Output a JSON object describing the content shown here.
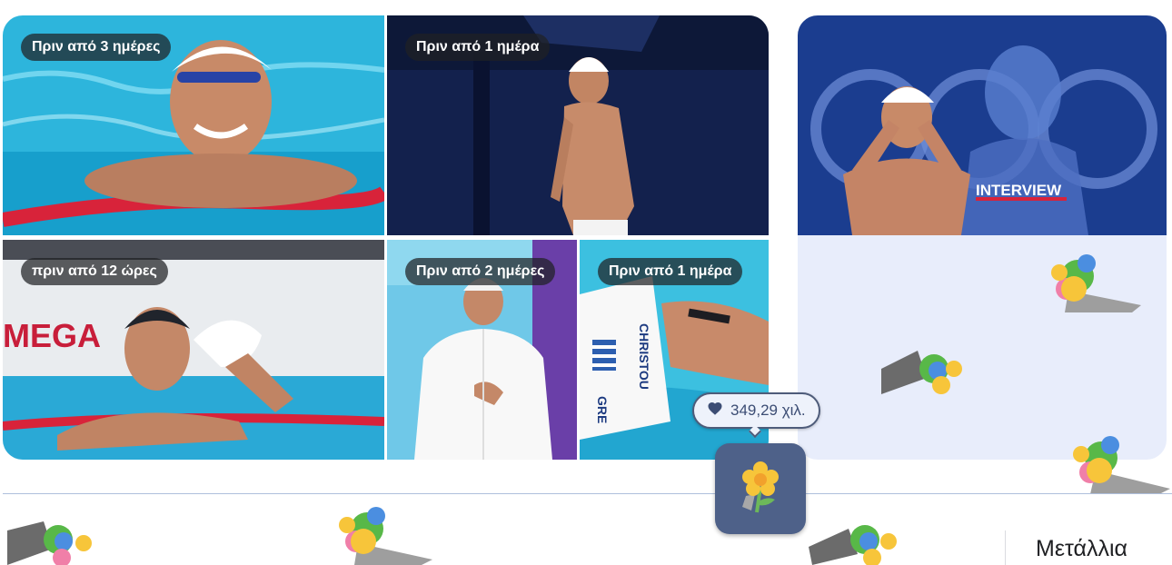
{
  "gallery": {
    "tiles": [
      {
        "badge": "Πριν από 3 ημέρες",
        "scene": "swimmer-smiling-in-pool"
      },
      {
        "badge": "Πριν από 1 ημέρα",
        "scene": "swimmer-on-starting-block"
      },
      {
        "badge": "πριν από 12 ώρες",
        "scene": "swimmer-holding-cap-at-wall"
      },
      {
        "badge": "Πριν από 2 ημέρες",
        "scene": "swimmer-in-white-jacket"
      },
      {
        "badge": "Πριν από 1 ημέρα",
        "scene": "swimmer-backstroke-cap-gre"
      }
    ]
  },
  "side_card": {
    "image_overlay_text": "INTERVIEW",
    "scene": "swimmer-interview-olympic-rings"
  },
  "tile_texts": {
    "omega": "MEGA",
    "cap_gre": "GRE",
    "cap_name": "CHRISTOU"
  },
  "reaction": {
    "likes": "349,29 χιλ.",
    "icon": "heart-icon",
    "button_icon": "flower-icon"
  },
  "medals_label": "Μετάλλια",
  "colors": {
    "pill_bg": "#eef2fb",
    "pill_border": "#4e5c7a",
    "flower_button": "#4e6189",
    "card_bg": "#e8edfb",
    "divider": "#aebfdc"
  }
}
